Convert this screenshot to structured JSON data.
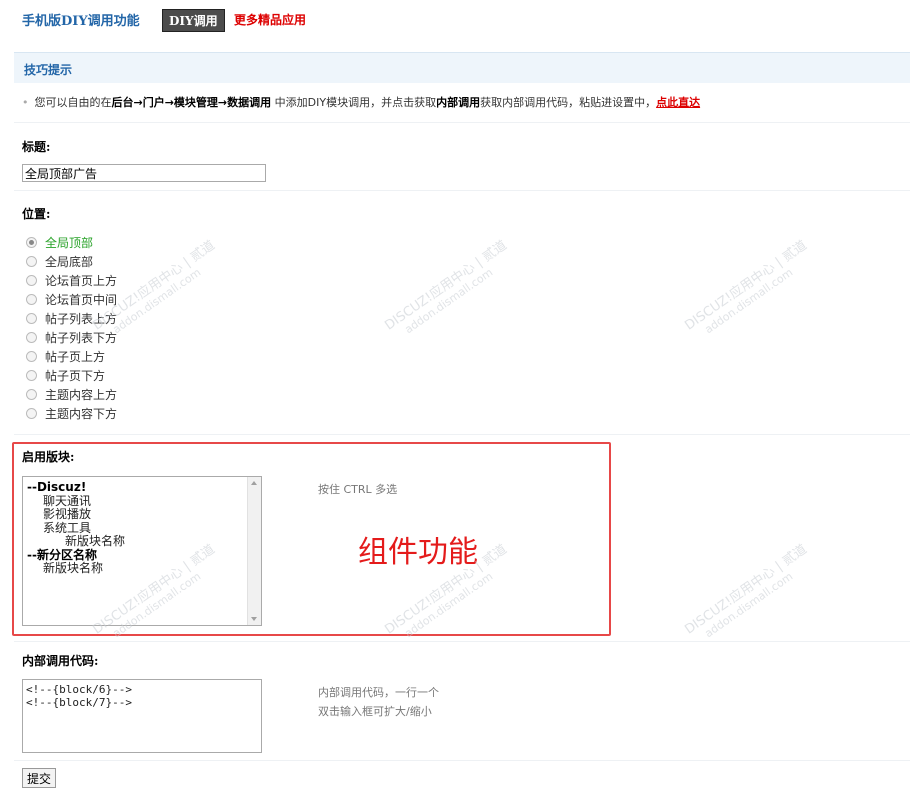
{
  "header": {
    "title": "手机版DIY调用功能",
    "tab_diy": "DIY调用",
    "tab_more": "更多精品应用"
  },
  "tips": {
    "title": "技巧提示",
    "bullet": "•",
    "text_1": "您可以自由的在",
    "text_bold_1": "后台→门户→模块管理→数据调用",
    "text_2": "中添加DIY模块调用，并点击获取",
    "text_bold_2": "内部调用",
    "text_3": "获取内部调用代码，粘贴进设置中，",
    "link": "点此直达"
  },
  "title_field": {
    "label": "标题:",
    "value": "全局顶部广告"
  },
  "position": {
    "label": "位置:",
    "options": [
      "全局顶部",
      "全局底部",
      "论坛首页上方",
      "论坛首页中间",
      "帖子列表上方",
      "帖子列表下方",
      "帖子页上方",
      "帖子页下方",
      "主题内容上方",
      "主题内容下方"
    ],
    "selected": "全局顶部"
  },
  "blocks": {
    "label": "启用版块:",
    "hint": "按住 CTRL 多选",
    "annotation": "组件功能",
    "items": [
      "--Discuz!",
      "聊天通讯",
      "影视播放",
      "系统工具",
      "新版块名称",
      "--新分区名称",
      "新版块名称"
    ]
  },
  "code": {
    "label": "内部调用代码:",
    "value": "<!--{block/6}-->\n<!--{block/7}-->",
    "hint_1": "内部调用代码，一行一个",
    "hint_2": "双击输入框可扩大/缩小"
  },
  "submit_label": "提交",
  "watermark": {
    "line_1": "DISCUZ!应用中心 | 贰道",
    "line_2": "addon.dismall.com"
  }
}
